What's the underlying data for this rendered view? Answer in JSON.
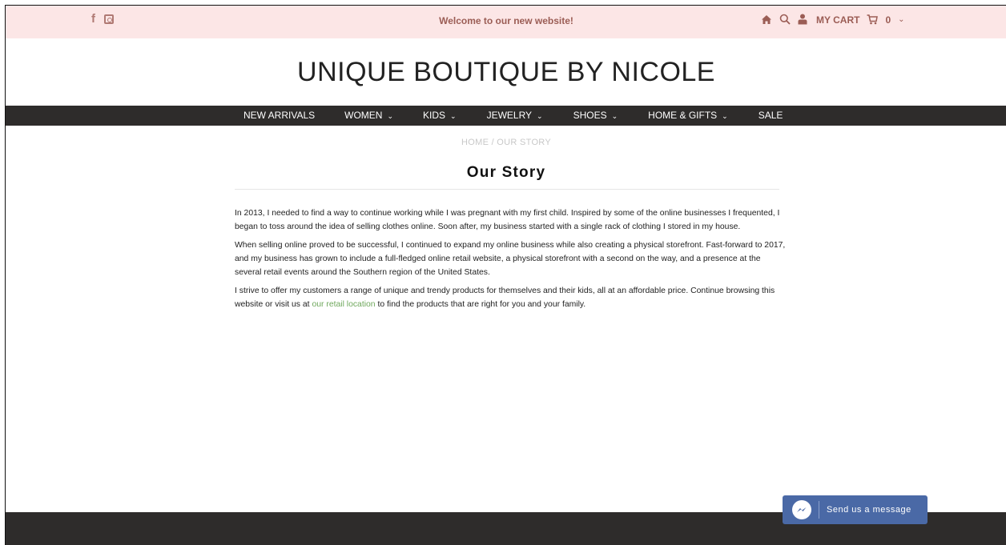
{
  "topbar": {
    "social": [
      "facebook-icon",
      "instagram-icon"
    ],
    "welcome": "Welcome to our new website!",
    "cart_label": "MY CART",
    "cart_count": "0"
  },
  "logo": "UNIQUE BOUTIQUE BY NICOLE",
  "nav": {
    "items": [
      {
        "label": "NEW ARRIVALS"
      },
      {
        "label": "WOMEN"
      },
      {
        "label": "KIDS"
      },
      {
        "label": "JEWELRY"
      },
      {
        "label": "SHOES"
      },
      {
        "label": "HOME & GIFTS"
      },
      {
        "label": "SALE"
      }
    ]
  },
  "breadcrumb": {
    "home": "HOME",
    "separator": "/",
    "current": "OUR STORY"
  },
  "page": {
    "title": "Our Story",
    "paragraphs": [
      "In 2013, I needed to find a way to continue working while I was pregnant with my first child. Inspired by some of the online businesses I frequented, I began to toss around the idea of selling clothes online. Soon after, my business started with a single rack of clothing I stored in my house.",
      "When selling online proved to be successful, I continued to expand my online business while also creating a physical storefront. Fast-forward to 2017, and my business has grown to include a full-fledged online retail website, a physical storefront with a second on the way, and a presence at the several retail events around the Southern region of the United States."
    ],
    "p3_before": "I strive to offer my customers a range of unique and trendy products for themselves and their kids, all at an affordable price. Continue browsing this website or visit us at ",
    "p3_link": "our retail location",
    "p3_after": " to find the products that are right for you and your family."
  },
  "messenger": {
    "label": "Send us a message"
  },
  "colors": {
    "topbar_bg": "#fce6e6",
    "topbar_text": "#9b5d55",
    "nav_bg": "#2e2c2b",
    "link": "#6fa85c",
    "messenger_bg": "#4a69a6"
  }
}
